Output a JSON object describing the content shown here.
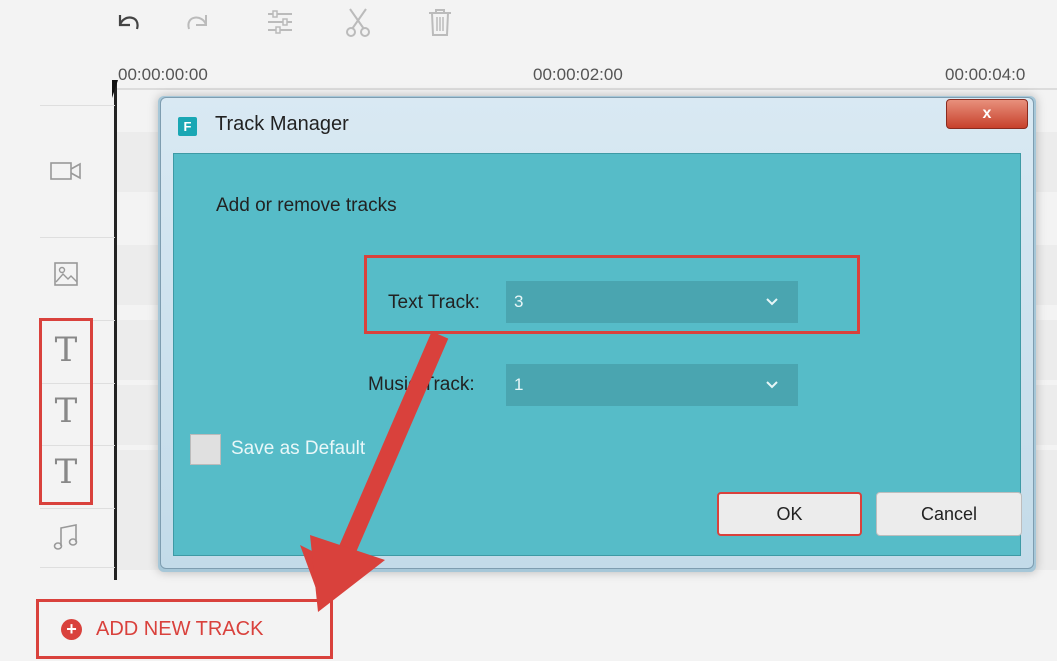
{
  "toolbar": {
    "icons": [
      "undo-icon",
      "redo-icon",
      "adjust-icon",
      "cut-icon",
      "delete-icon"
    ]
  },
  "timeline": {
    "time_labels": [
      "00:00:00:00",
      "00:00:02:00",
      "00:00:04:0"
    ]
  },
  "tracks": {
    "icons": [
      "video-track-icon",
      "image-track-icon",
      "text-track-icon",
      "text-track-icon",
      "text-track-icon",
      "music-track-icon"
    ],
    "text_glyph": "T"
  },
  "dialog": {
    "title": "Track Manager",
    "app_badge": "F",
    "close_label": "x",
    "instruction": "Add or remove tracks",
    "text_track_label": "Text Track:",
    "text_track_value": "3",
    "music_track_label": "Music Track:",
    "music_track_value": "1",
    "save_default_label": "Save as Default",
    "ok_label": "OK",
    "cancel_label": "Cancel"
  },
  "add_track": {
    "label": "ADD NEW TRACK"
  },
  "colors": {
    "highlight": "#d9413c",
    "dialog_body": "#56bcc8",
    "select_bg": "#4aa5b0"
  }
}
